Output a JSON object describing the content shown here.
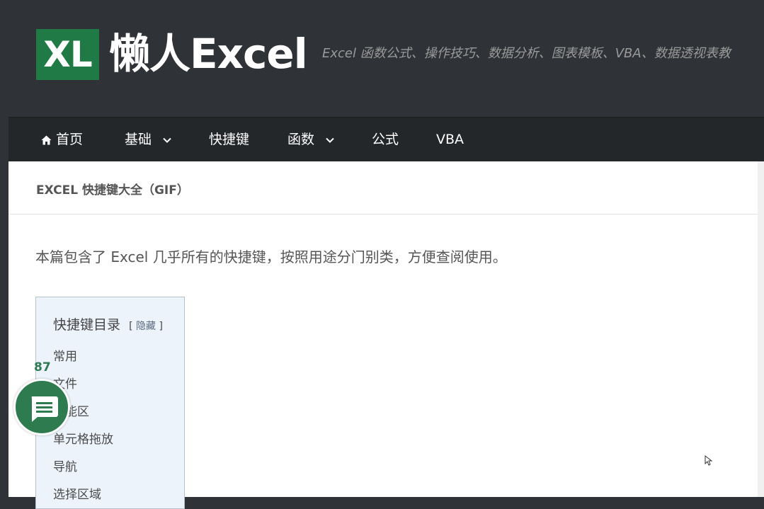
{
  "header": {
    "logo_mark": "XL",
    "site_name": "懒人Excel",
    "tagline": "Excel 函数公式、操作技巧、数据分析、图表模板、VBA、数据透视表教"
  },
  "nav": {
    "items": [
      {
        "label": "首页",
        "icon": "home-icon"
      },
      {
        "label": "基础",
        "icon": "chevron-down-icon"
      },
      {
        "label": "快捷键"
      },
      {
        "label": "函数",
        "icon": "chevron-down-icon"
      },
      {
        "label": "公式"
      },
      {
        "label": "VBA"
      }
    ]
  },
  "breadcrumb": {
    "title": "EXCEL 快捷键大全（GIF）"
  },
  "main": {
    "intro": "本篇包含了 Excel 几乎所有的快捷键，按照用途分门别类，方便查阅使用。"
  },
  "toc": {
    "title": "快捷键目录",
    "toggle_open": "[",
    "toggle_label": "隐藏",
    "toggle_close": "]",
    "items": [
      "常用",
      "文件",
      "功能区",
      "单元格拖放",
      "导航",
      "选择区域"
    ]
  },
  "share": {
    "count": "87",
    "icon": "message-icon"
  },
  "colors": {
    "header_bg": "#2f3236",
    "nav_bg": "#24272a",
    "brand_green": "#1f7a45",
    "toc_bg": "#ecf3fb"
  }
}
